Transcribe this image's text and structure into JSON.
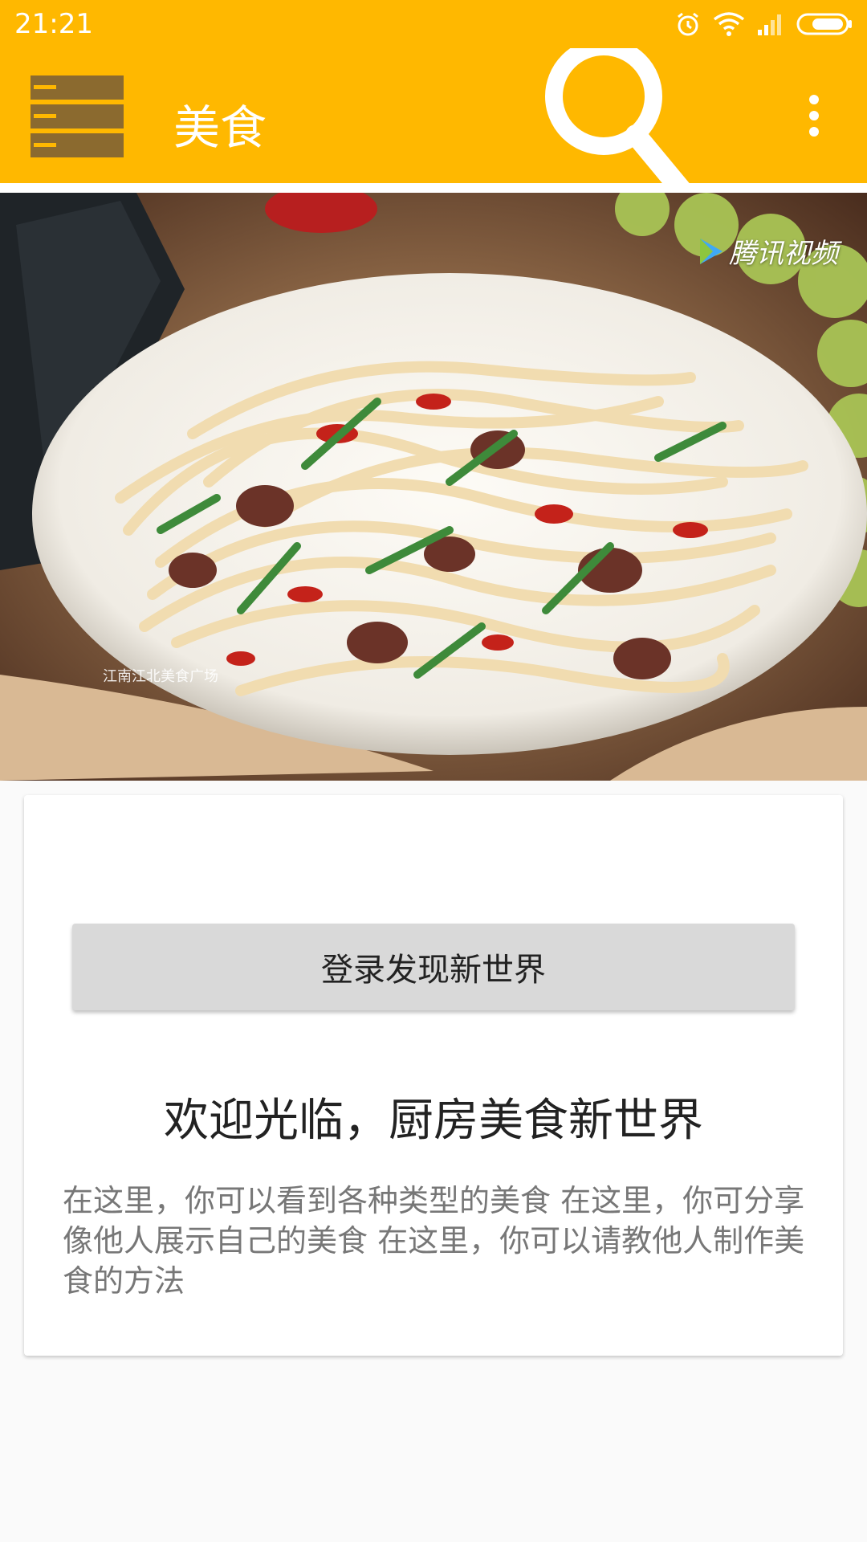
{
  "status_bar": {
    "time": "21:21",
    "icons": [
      "alarm-icon",
      "wifi-icon",
      "signal-icon",
      "battery-icon"
    ]
  },
  "toolbar": {
    "title": "美食",
    "menu_icon": "menu-icon",
    "search_icon": "search-icon",
    "more_icon": "more-vert-icon",
    "background": "#FFB800"
  },
  "hero": {
    "watermark": "腾讯视频",
    "caption": "江南江北美食广场"
  },
  "card": {
    "login_button": "登录发现新世界",
    "welcome_title": "欢迎光临，厨房美食新世界",
    "description": "在这里，你可以看到各种类型的美食 在这里，你可分享像他人展示自己的美食 在这里，你可以请教他人制作美食的方法"
  }
}
